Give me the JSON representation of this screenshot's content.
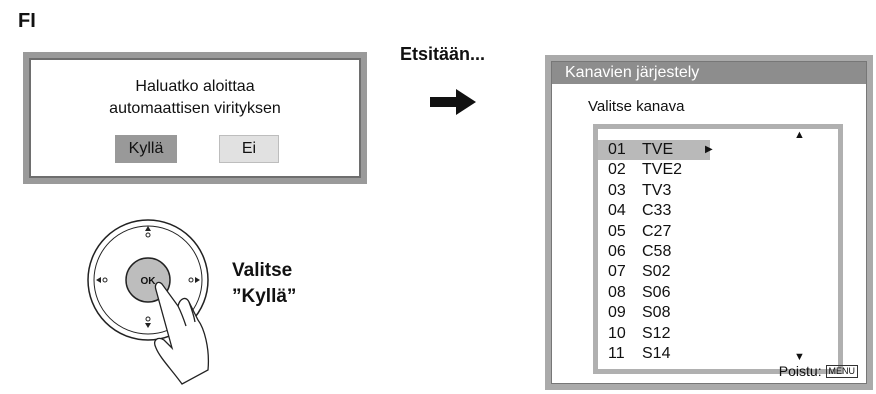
{
  "language_label": "FI",
  "dialog": {
    "question_line1": "Haluatko aloittaa",
    "question_line2": "automaattisen virityksen",
    "yes_label": "Kyllä",
    "no_label": "Ei"
  },
  "searching_label": "Etsitään...",
  "remote": {
    "ok_label": "OK",
    "caption_line1": "Valitse",
    "caption_line2": "”Kyllä”"
  },
  "channel_menu": {
    "title": "Kanavien järjestely",
    "subtitle": "Valitse kanava",
    "selected_index": 0,
    "channels": [
      {
        "number": "01",
        "name": "TVE"
      },
      {
        "number": "02",
        "name": "TVE2"
      },
      {
        "number": "03",
        "name": "TV3"
      },
      {
        "number": "04",
        "name": "C33"
      },
      {
        "number": "05",
        "name": "C27"
      },
      {
        "number": "06",
        "name": "C58"
      },
      {
        "number": "07",
        "name": "S02"
      },
      {
        "number": "08",
        "name": "S06"
      },
      {
        "number": "09",
        "name": "S08"
      },
      {
        "number": "10",
        "name": "S12"
      },
      {
        "number": "11",
        "name": "S14"
      }
    ],
    "footer_label": "Poistu:",
    "footer_key": "MENU"
  },
  "icons": [
    "right-arrow-icon",
    "up-arrow-icon",
    "down-arrow-icon",
    "hand-icon"
  ]
}
